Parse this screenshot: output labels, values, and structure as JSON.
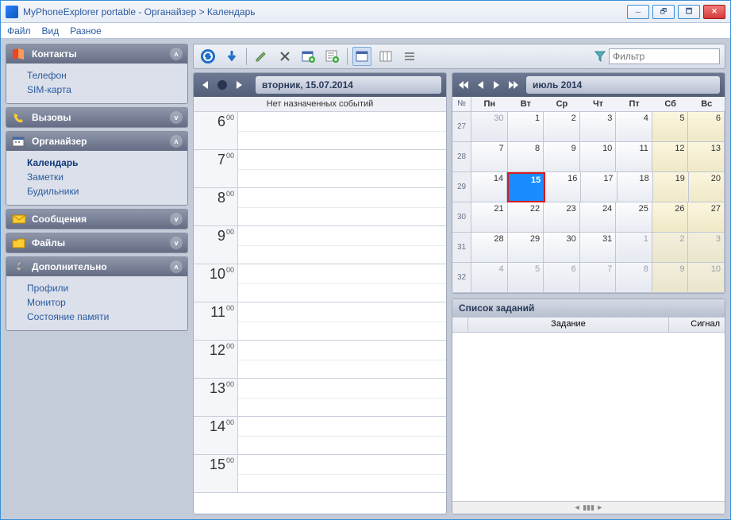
{
  "window": {
    "title": "MyPhoneExplorer portable -  Органайзер > Календарь"
  },
  "menu": {
    "file": "Файл",
    "view": "Вид",
    "misc": "Разное"
  },
  "sidebar": {
    "contacts": {
      "label": "Контакты",
      "items": [
        "Телефон",
        "SIM-карта"
      ]
    },
    "calls": {
      "label": "Вызовы"
    },
    "organizer": {
      "label": "Органайзер",
      "items": [
        "Календарь",
        "Заметки",
        "Будильники"
      ],
      "active": 0
    },
    "messages": {
      "label": "Сообщения"
    },
    "files": {
      "label": "Файлы"
    },
    "extra": {
      "label": "Дополнительно",
      "items": [
        "Профили",
        "Монитор",
        "Состояние памяти"
      ]
    }
  },
  "filter": {
    "placeholder": "Фильтр"
  },
  "day": {
    "title": "вторник, 15.07.2014",
    "no_events": "Нет назначенных событий",
    "hours": [
      "6",
      "7",
      "8",
      "9",
      "10",
      "11",
      "12",
      "13",
      "14",
      "15"
    ],
    "min": "00"
  },
  "month": {
    "title": "июль 2014",
    "wk_label": "№",
    "dow": [
      "Пн",
      "Вт",
      "Ср",
      "Чт",
      "Пт",
      "Сб",
      "Вс"
    ],
    "weeks": [
      {
        "no": "27",
        "days": [
          [
            "30",
            "o"
          ],
          [
            "1",
            ""
          ],
          [
            "2",
            ""
          ],
          [
            "3",
            ""
          ],
          [
            "4",
            ""
          ],
          [
            "5",
            "w"
          ],
          [
            "6",
            "w"
          ]
        ]
      },
      {
        "no": "28",
        "days": [
          [
            "7",
            ""
          ],
          [
            "8",
            ""
          ],
          [
            "9",
            ""
          ],
          [
            "10",
            ""
          ],
          [
            "11",
            ""
          ],
          [
            "12",
            "w"
          ],
          [
            "13",
            "w"
          ]
        ]
      },
      {
        "no": "29",
        "days": [
          [
            "14",
            ""
          ],
          [
            "15",
            "t"
          ],
          [
            "16",
            ""
          ],
          [
            "17",
            ""
          ],
          [
            "18",
            ""
          ],
          [
            "19",
            "w"
          ],
          [
            "20",
            "w"
          ]
        ]
      },
      {
        "no": "30",
        "days": [
          [
            "21",
            ""
          ],
          [
            "22",
            ""
          ],
          [
            "23",
            ""
          ],
          [
            "24",
            ""
          ],
          [
            "25",
            ""
          ],
          [
            "26",
            "w"
          ],
          [
            "27",
            "w"
          ]
        ]
      },
      {
        "no": "31",
        "days": [
          [
            "28",
            ""
          ],
          [
            "29",
            ""
          ],
          [
            "30",
            ""
          ],
          [
            "31",
            ""
          ],
          [
            "1",
            "o"
          ],
          [
            "2",
            "ow"
          ],
          [
            "3",
            "ow"
          ]
        ]
      },
      {
        "no": "32",
        "days": [
          [
            "4",
            "o"
          ],
          [
            "5",
            "o"
          ],
          [
            "6",
            "o"
          ],
          [
            "7",
            "o"
          ],
          [
            "8",
            "o"
          ],
          [
            "9",
            "ow"
          ],
          [
            "10",
            "ow"
          ]
        ]
      }
    ]
  },
  "tasks": {
    "title": "Список заданий",
    "col_task": "Задание",
    "col_signal": "Сигнал"
  }
}
